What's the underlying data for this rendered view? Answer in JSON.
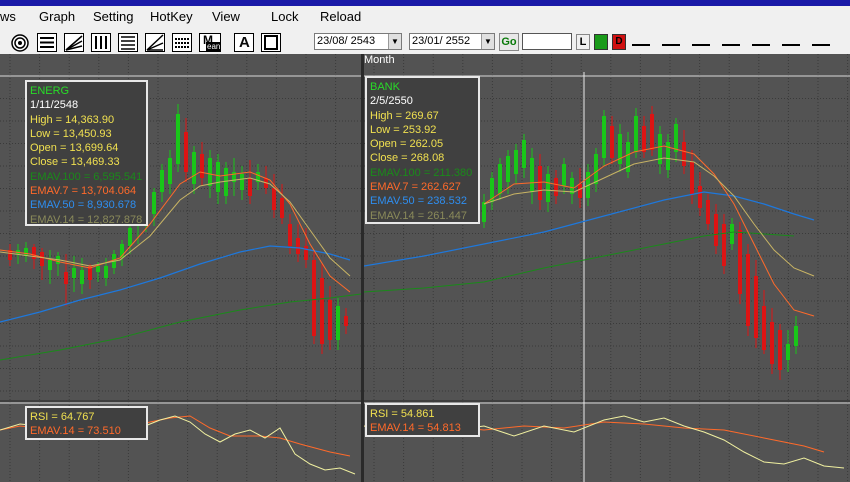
{
  "menu": [
    "ws",
    "Graph",
    "Setting",
    "HotKey",
    "View",
    "Lock",
    "Reload"
  ],
  "toolbar": {
    "icons": [
      "chart-view-icon",
      "horizontal-lines-icon",
      "fan-lines-icon",
      "vertical-lines-icon",
      "horizontal-bars-icon",
      "angle-lines-icon",
      "dotted-lines-icon",
      "moving-average-icon",
      "font-a-icon",
      "text-tool-icon"
    ],
    "icon_label_ma": "M",
    "icon_label_ma_sub": "ean",
    "icon_label_a": "A",
    "from_date": "23/08/ 2543",
    "to_date": "23/01/ 2552",
    "go_label": "Go",
    "color_buttons": [
      {
        "label": "L",
        "color": "#f0f0f0"
      },
      {
        "label": "",
        "color": "#1a9a1a"
      },
      {
        "label": "D",
        "color": "#d01010"
      }
    ]
  },
  "left_chart": {
    "symbol": "ENERG",
    "date": "1/11/2548",
    "high": "High  = 14,363.90",
    "low": "Low  = 13,450.93",
    "open": "Open = 13,699.64",
    "close": "Close = 13,469.33",
    "ema100": "EMAV.100 = 6,595.541",
    "ema7": "EMAV.7 = 13,704.064",
    "ema50": "EMAV.50 = 8,930.678",
    "ema14": "EMAV.14 = 12,827.878",
    "rsi": "RSI = 64.767",
    "rsi_ema14": "EMAV.14 = 73.510"
  },
  "right_chart": {
    "period": "Month",
    "symbol": "BANK",
    "date": "2/5/2550",
    "high": "High  = 269.67",
    "low": "Low   = 253.92",
    "open": "Open = 262.05",
    "close": "Close = 268.08",
    "ema100": "EMAV.100 = 211.380",
    "ema7": "EMAV.7 = 262.627",
    "ema50": "EMAV.50 = 238.532",
    "ema14": "EMAV.14 = 261.447",
    "rsi": "RSI = 54.861",
    "rsi_ema14": "EMAV.14 = 54.813"
  },
  "colors": {
    "bull": "#19c619",
    "bear": "#dc1414",
    "ema7": "#ff6a2a",
    "ema14": "#c8b464",
    "ema50": "#1e78dc",
    "ema100": "#1a8a1a",
    "rsi": "#f0f0a0",
    "rsi_ema": "#ff6a2a",
    "symbol": "#28dc28",
    "ohlc": "#f0e050"
  }
}
